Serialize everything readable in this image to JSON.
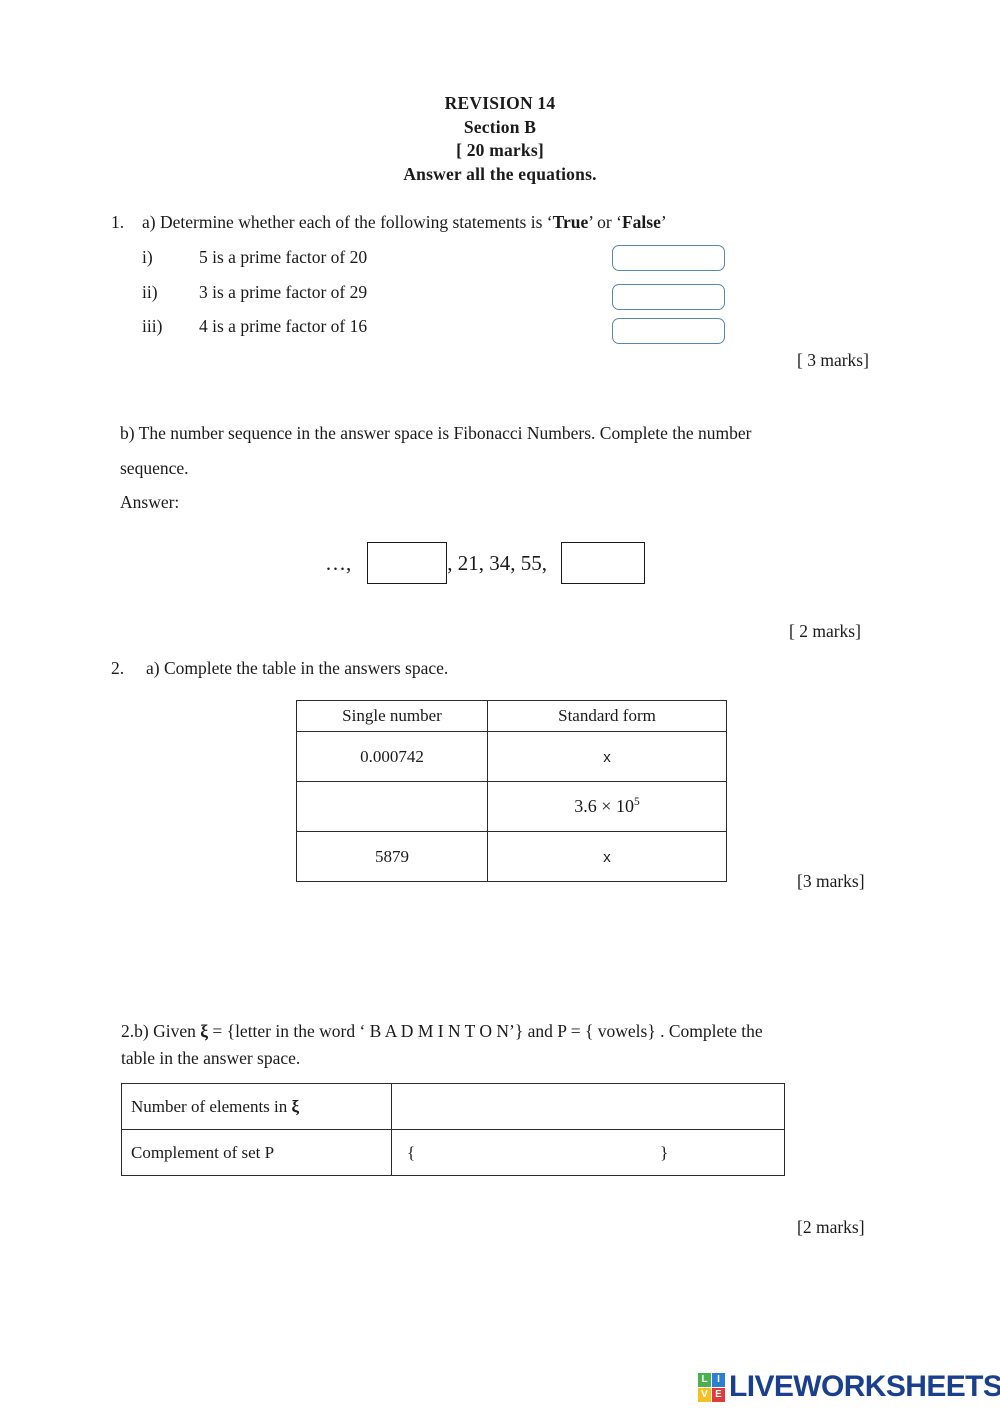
{
  "header": {
    "line1": "REVISION 14",
    "line2": "Section B",
    "line3": "[ 20 marks]",
    "line4": "Answer all the equations."
  },
  "question1": {
    "number": "1.",
    "part_a_prefix": "a) Determine whether each of the following statements is ‘",
    "true_word": "True",
    "mid": "’ or ‘",
    "false_word": "False",
    "suffix": "’",
    "items": [
      {
        "roman": "i)",
        "text": "5 is a prime factor of 20",
        "answer": ""
      },
      {
        "roman": "ii)",
        "text": "3 is a prime factor of 29",
        "answer": ""
      },
      {
        "roman": "iii)",
        "text": "4 is a prime factor of 16",
        "answer": ""
      }
    ],
    "marks_a": "[ 3 marks]",
    "part_b_line1": "b) The number sequence in the answer space is Fibonacci Numbers. Complete the number",
    "part_b_line2": "sequence.",
    "answer_label": "Answer:",
    "sequence": {
      "leading": "…,",
      "blank1": "",
      "middle": ", 21, 34, 55,",
      "blank2": ""
    },
    "marks_b": "[ 2 marks]"
  },
  "question2": {
    "number": "2.",
    "part_a": "a) Complete the table in the answers space.",
    "table_standard_form": {
      "headers": [
        "Single number",
        "Standard form"
      ],
      "rows": [
        {
          "single": "0.000742",
          "standard": "x",
          "standard_is_placeholder": true
        },
        {
          "single": "",
          "standard_mantissa": "3.6 × 10",
          "standard_exponent": "5",
          "standard_is_placeholder": false
        },
        {
          "single": "5879",
          "standard": "x",
          "standard_is_placeholder": true
        }
      ]
    },
    "marks_a": "[3 marks]",
    "part_b_line1_pre": "2.b) Given ",
    "part_b_xi": "ξ",
    "part_b_line1_post": " = {letter in the word ‘ B A D M I N T O N’} and P = { vowels} . Complete the",
    "part_b_line2": "table in the answer space.",
    "table_sets": {
      "row1_label_pre": "Number of elements in ",
      "row1_label_xi": "ξ",
      "row1_value": "",
      "row2_label": "Complement of set P",
      "row2_brace_open": "{",
      "row2_value": "",
      "row2_brace_close": "}"
    },
    "marks_b": "[2 marks]"
  },
  "footer": {
    "logo_tiles": [
      {
        "letter": "L",
        "color": "#4CAF50"
      },
      {
        "letter": "I",
        "color": "#2F7FD1"
      },
      {
        "letter": "V",
        "color": "#F5C021"
      },
      {
        "letter": "E",
        "color": "#E03A3A"
      }
    ],
    "logo_text": "LIVEWORKSHEETS",
    "logo_text_color": "#1b3f8f"
  }
}
